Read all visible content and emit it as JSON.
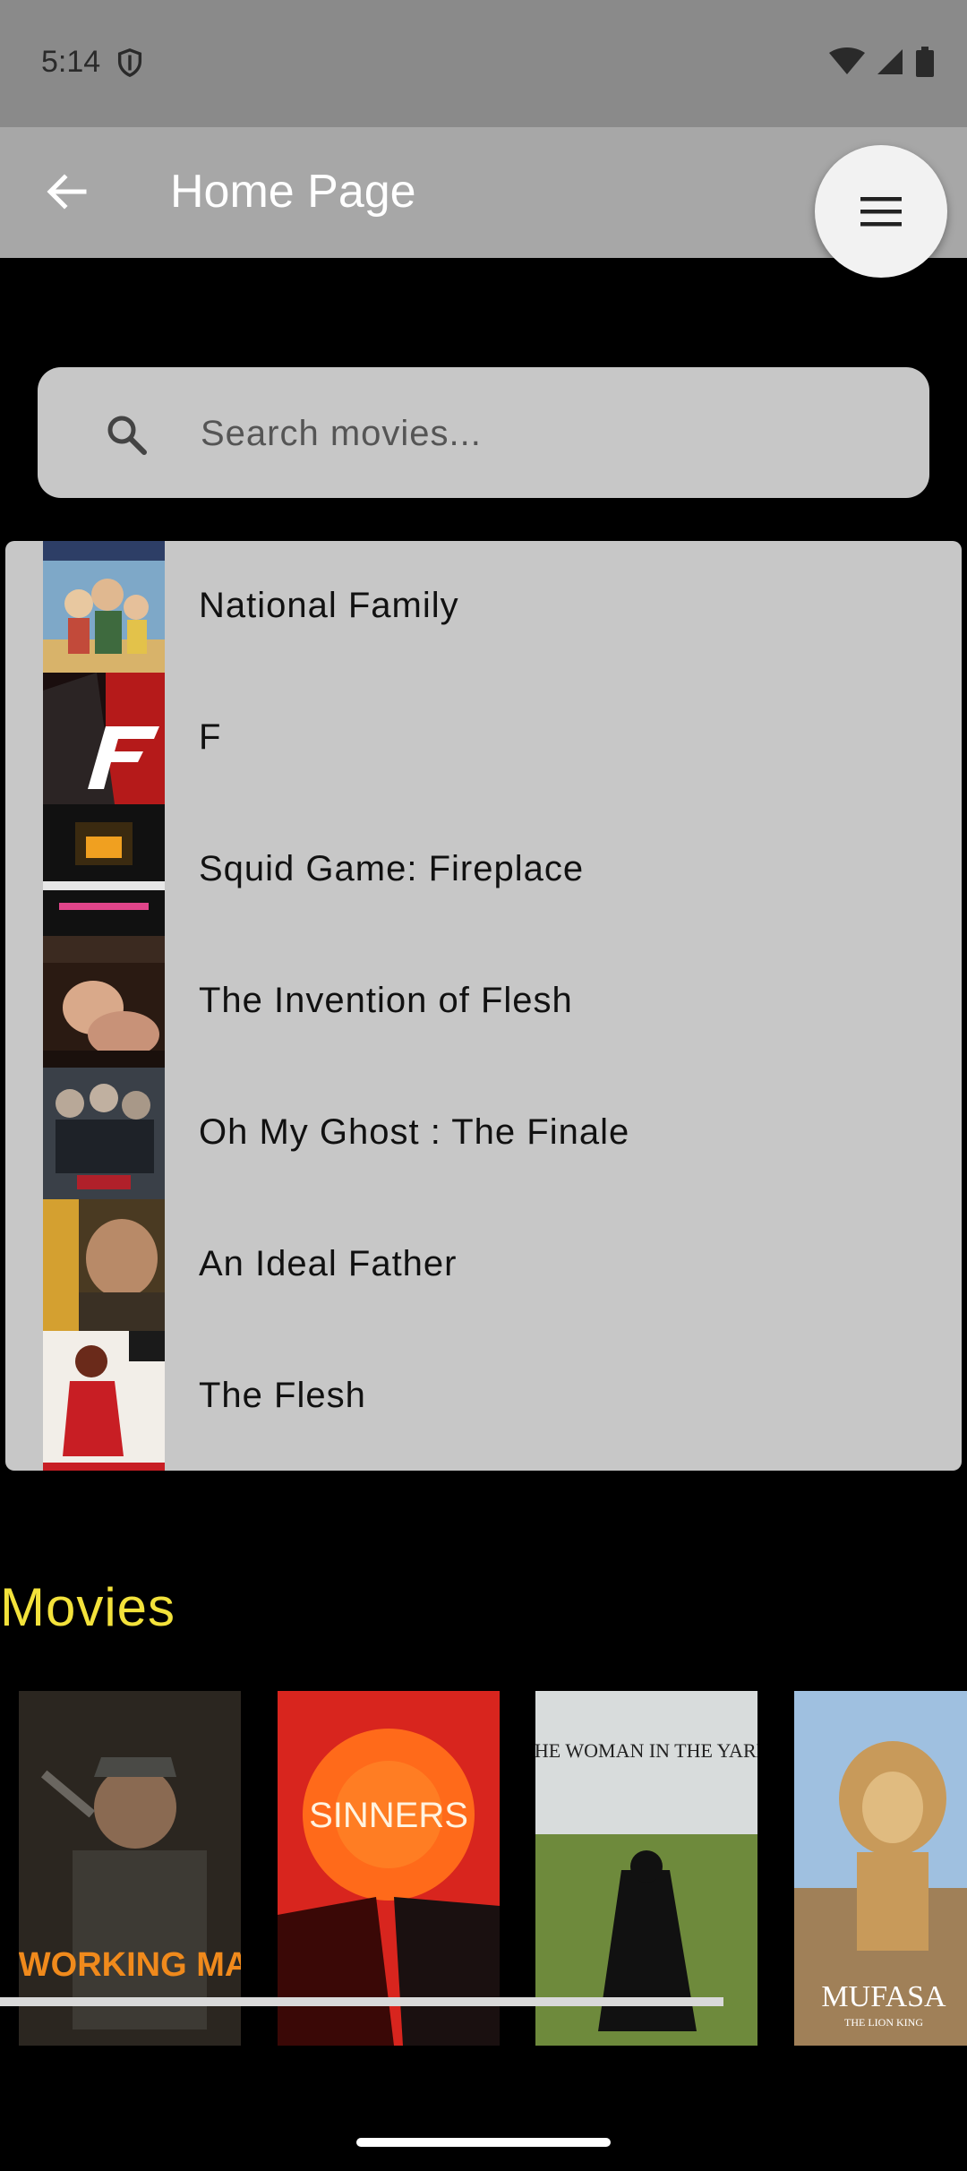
{
  "status_bar": {
    "time": "5:14",
    "icons": [
      "shield-icon",
      "wifi-icon",
      "signal-icon",
      "battery-icon"
    ]
  },
  "app_bar": {
    "title": "Home Page",
    "back_icon": "arrow-left-icon",
    "menu_icon": "hamburger-menu-icon"
  },
  "search": {
    "placeholder": "Search movies...",
    "value": "",
    "icon": "search-icon"
  },
  "results": [
    {
      "title": "National Family"
    },
    {
      "title": "F"
    },
    {
      "title": "Squid Game: Fireplace"
    },
    {
      "title": "The Invention of Flesh"
    },
    {
      "title": "Oh My Ghost : The Finale"
    },
    {
      "title": "An Ideal Father"
    },
    {
      "title": "The Flesh"
    }
  ],
  "movies_section": {
    "title": "Movies",
    "posters": [
      {
        "caption": "A WORKING MAN"
      },
      {
        "caption": "SINNERS"
      },
      {
        "caption": "THE WOMAN IN THE YARD"
      },
      {
        "caption": "MUFASA",
        "subcaption": "THE LION KING"
      }
    ]
  },
  "colors": {
    "background": "#000000",
    "status_bar": "#8a8a8a",
    "app_bar": "#a7a7a7",
    "surface": "#c7c7c7",
    "section_title": "#f3e23b"
  }
}
